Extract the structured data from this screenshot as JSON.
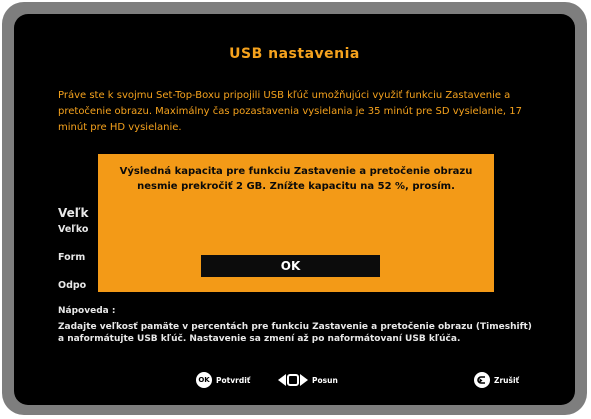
{
  "screen": {
    "title": "USB nastavenia",
    "intro": "Práve ste k svojmu Set-Top-Boxu pripojili USB kľúč umožňujúci využiť funkciu Zastavenie a pretočenie obrazu. Maximálny čas pozastavenia vysielania je 35 minút pre SD vysielanie, 17 minút pre HD vysielanie.",
    "section_heading": "Veľk",
    "fields": [
      {
        "label": "Veľko"
      },
      {
        "label": "Form"
      },
      {
        "label": "Odpo"
      }
    ],
    "help_label": "Nápoveda :",
    "help_text": "Zadajte veľkosť pamäte v percentách pre funkciu Zastavenie a pretočenie obrazu (Timeshift) a naformátujte USB kľúč. Nastavenie sa zmení až po naformátovaní USB kľúča."
  },
  "footer": {
    "ok_icon_text": "OK",
    "confirm_label": "Potvrdiť",
    "move_label": "Posun",
    "cancel_label": "Zrušiť"
  },
  "dialog": {
    "message": "Výsledná kapacita pre funkciu Zastavenie a pretočenie obrazu nesmie prekročiť 2 GB. Znížte kapacitu na 52 %, prosím.",
    "ok_label": "OK"
  },
  "colors": {
    "accent": "#f5a21d",
    "dialog_bg": "#f39a17",
    "screen_bg": "#000000",
    "frame": "#7e7e7e"
  },
  "icons": [
    "ok-button-icon",
    "nav-arrows-icon",
    "back-icon"
  ]
}
